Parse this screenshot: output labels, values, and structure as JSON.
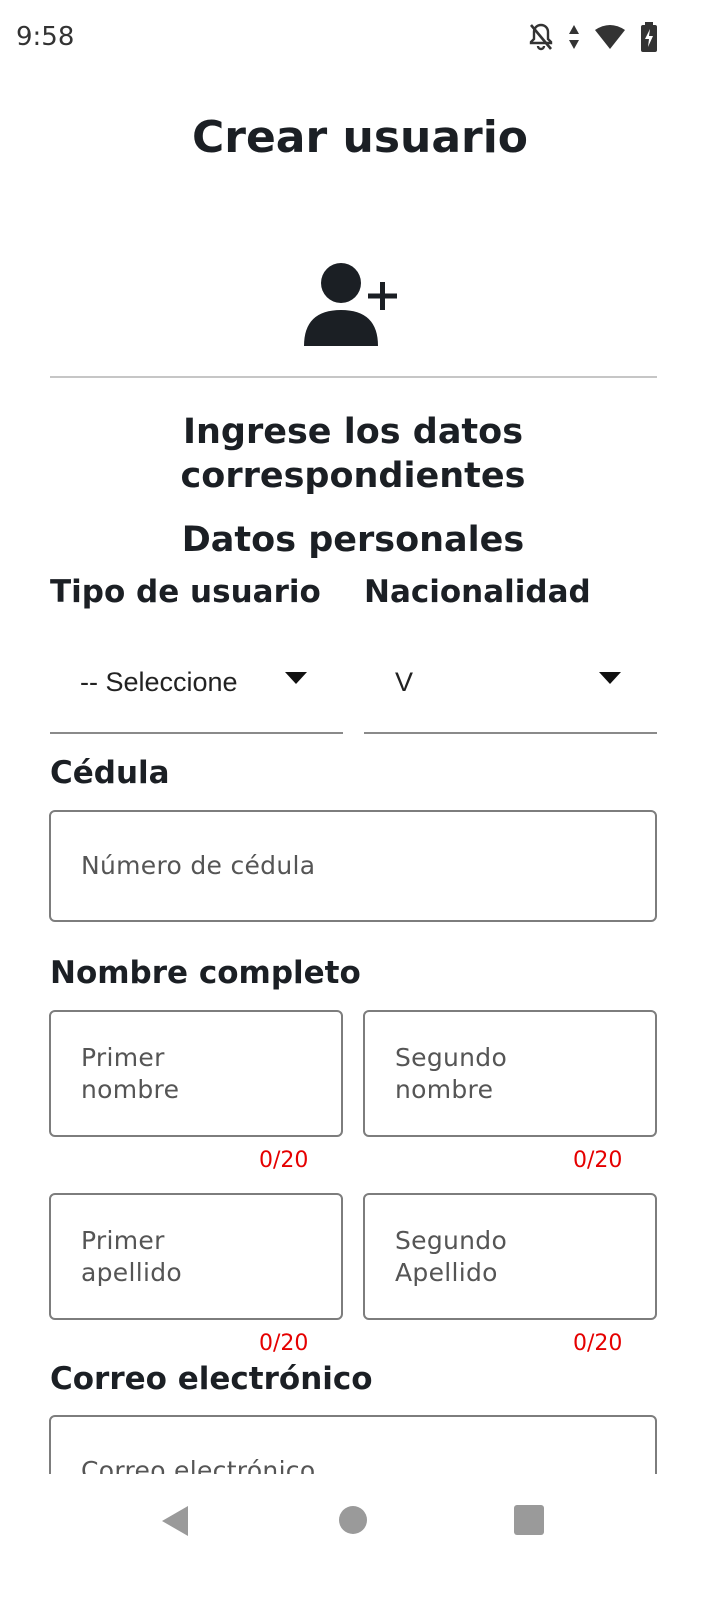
{
  "status_bar": {
    "time": "9:58",
    "icons": [
      "notifications-off-icon",
      "data-arrows-icon",
      "wifi-icon",
      "battery-charging-icon"
    ]
  },
  "header": {
    "title": "Crear usuario"
  },
  "avatar": {
    "icon": "person-add-icon"
  },
  "intro": {
    "line1": "Ingrese los datos",
    "line2": "correspondientes"
  },
  "section": {
    "title": "Datos personales"
  },
  "form": {
    "user_type": {
      "label": "Tipo de usuario",
      "value": "-- Seleccione"
    },
    "nationality": {
      "label": "Nacionalidad",
      "value": "V"
    },
    "id_number": {
      "label": "Cédula",
      "placeholder": "Número de cédula"
    },
    "full_name": {
      "label": "Nombre completo",
      "first_name": {
        "line1": "Primer",
        "line2": "nombre",
        "counter": "0/20"
      },
      "second_name": {
        "line1": "Segundo",
        "line2": "nombre",
        "counter": "0/20"
      },
      "first_surname": {
        "line1": "Primer",
        "line2": "apellido",
        "counter": "0/20"
      },
      "second_surname": {
        "line1": "Segundo",
        "line2": "Apellido",
        "counter": "0/20"
      }
    },
    "email": {
      "label": "Correo electrónico",
      "placeholder": "Correo electrónico"
    }
  },
  "navigation": {
    "back": "back-icon",
    "home": "home-icon",
    "recents": "recents-icon"
  },
  "colors": {
    "counter": "#e50000",
    "text": "#1b1f24",
    "border": "#7d7d7d"
  }
}
